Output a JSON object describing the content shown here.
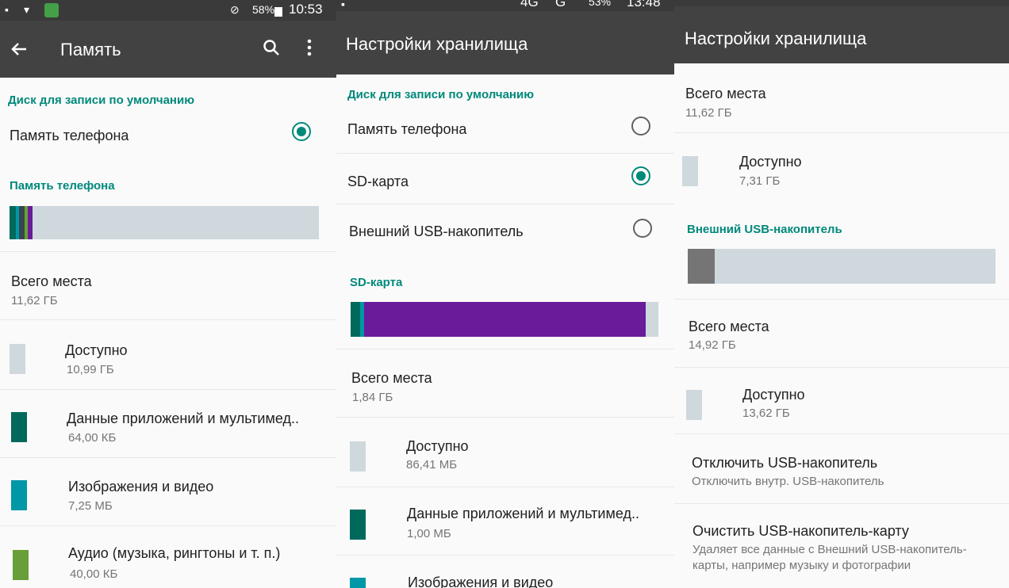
{
  "colors": {
    "accent": "#00897b",
    "free": "#cfd8dc",
    "apps": "#00695c",
    "images": "#0097a7",
    "audio": "#689f38",
    "purple": "#6a1b9a",
    "usb_used": "#757575"
  },
  "p1": {
    "status": {
      "battery": "58%",
      "time": "10:53"
    },
    "title": "Память",
    "back_icon": "arrow-left-icon",
    "search_icon": "search-icon",
    "more_icon": "more-vert-icon",
    "default_disk": {
      "header": "Диск для записи по умолчанию",
      "phone_label": "Память телефона",
      "phone_selected": true
    },
    "phone_section_header": "Память телефона",
    "usage_fractions": {
      "apps": 0.02,
      "images": 0.01,
      "audio": 0.02,
      "other": 0.01,
      "purple": 0.015
    },
    "total": {
      "label": "Всего места",
      "value": "11,62 ГБ"
    },
    "available": {
      "label": "Доступно",
      "value": "10,99 ГБ"
    },
    "apps": {
      "label": "Данные приложений и мультимед..",
      "value": "64,00 КБ"
    },
    "images": {
      "label": "Изображения и видео",
      "value": "7,25 МБ"
    },
    "audio": {
      "label": "Аудио (музыка, рингтоны и т. п.)",
      "value": "40,00 КБ"
    }
  },
  "p2": {
    "status": {
      "network": "4G",
      "network2": "G",
      "battery": "53%",
      "time": "13:48"
    },
    "title": "Настройки хранилища",
    "default_disk_header": "Диск для записи по умолчанию",
    "options": [
      {
        "label": "Память телефона",
        "selected": false
      },
      {
        "label": "SD-карта",
        "selected": true
      },
      {
        "label": "Внешний USB-накопитель",
        "selected": false
      }
    ],
    "sd_header": "SD-карта",
    "usage_fractions": {
      "apps": 0.03,
      "images": 0.015,
      "purple": 0.915
    },
    "total": {
      "label": "Всего места",
      "value": "1,84 ГБ"
    },
    "available": {
      "label": "Доступно",
      "value": "86,41 МБ"
    },
    "apps": {
      "label": "Данные приложений и мультимед..",
      "value": "1,00 МБ"
    },
    "images": {
      "label": "Изображения и видео"
    }
  },
  "p3": {
    "title": "Настройки хранилища",
    "phone_total": {
      "label": "Всего места",
      "value": "11,62 ГБ"
    },
    "phone_available": {
      "label": "Доступно",
      "value": "7,31 ГБ"
    },
    "usb_header": "Внешний USB-накопитель",
    "usb_used_fraction": 0.087,
    "usb_total": {
      "label": "Всего места",
      "value": "14,92 ГБ"
    },
    "usb_available": {
      "label": "Доступно",
      "value": "13,62 ГБ"
    },
    "unmount": {
      "title": "Отключить USB-накопитель",
      "subtitle": "Отключить внутр. USB-накопитель"
    },
    "erase": {
      "title": "Очистить USB-накопитель-карту",
      "subtitle_line1": "Удаляет все данные с Внешний USB-накопитель-",
      "subtitle_line2": "карты, например музыку и фотографии"
    }
  }
}
